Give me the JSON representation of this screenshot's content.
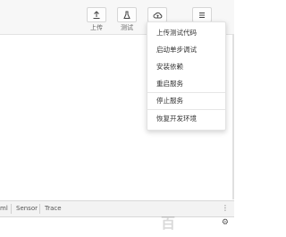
{
  "toolbar": {
    "buttons": [
      {
        "label": "上传",
        "icon": "upload-icon"
      },
      {
        "label": "测试",
        "icon": "test-icon"
      },
      {
        "label": "",
        "icon": "cloud-icon"
      },
      {
        "label": "",
        "icon": "menu-icon"
      }
    ]
  },
  "menu": {
    "items": [
      "上传测试代码",
      "启动单步调试",
      "安装依赖",
      "重启服务",
      "停止服务",
      "恢复开发环境"
    ]
  },
  "bottom_panel": {
    "tabs": [
      "ml",
      "Sensor",
      "Trace"
    ],
    "more_icon": "more-vertical-icon",
    "gear_icon": "gear-icon"
  },
  "watermark": {
    "text": "百"
  }
}
